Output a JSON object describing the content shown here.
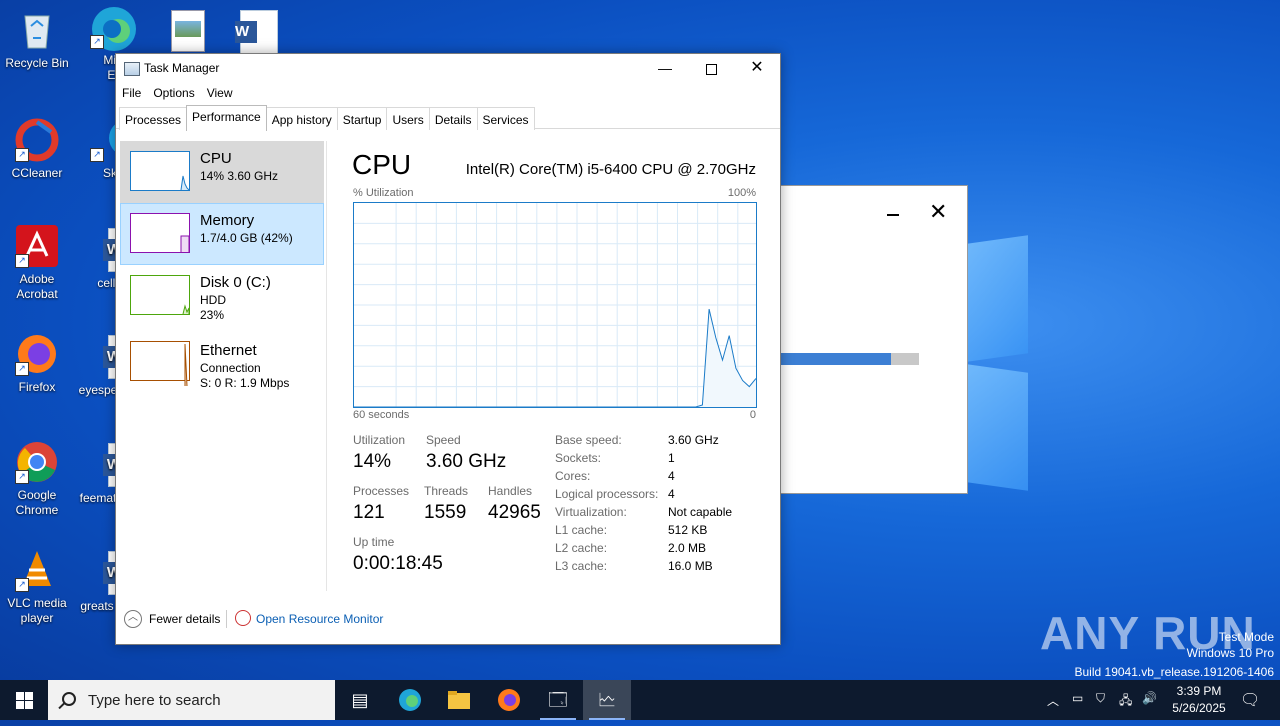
{
  "desktop": {
    "icons": [
      {
        "label": "Recycle Bin"
      },
      {
        "label": "Micro Edg"
      },
      {
        "label": "CCleaner"
      },
      {
        "label": "Sky"
      },
      {
        "label": "Adobe Acrobat"
      },
      {
        "label": "cellow"
      },
      {
        "label": "Firefox"
      },
      {
        "label": "eyespe"
      },
      {
        "label": "Google Chrome"
      },
      {
        "label": "feemat"
      },
      {
        "label": "VLC media player"
      },
      {
        "label": "greats"
      }
    ]
  },
  "task_manager": {
    "title": "Task Manager",
    "menu": [
      "File",
      "Options",
      "View"
    ],
    "tabs": [
      "Processes",
      "Performance",
      "App history",
      "Startup",
      "Users",
      "Details",
      "Services"
    ],
    "active_tab": "Performance",
    "resources": [
      {
        "name": "CPU",
        "line1": "14% 3.60 GHz",
        "line2": ""
      },
      {
        "name": "Memory",
        "line1": "1.7/4.0 GB (42%)",
        "line2": ""
      },
      {
        "name": "Disk 0 (C:)",
        "line1": "HDD",
        "line2": "23%"
      },
      {
        "name": "Ethernet",
        "line1": "Connection",
        "line2": "S: 0 R: 1.9 Mbps"
      }
    ],
    "detail": {
      "title": "CPU",
      "cpu_name": "Intel(R) Core(TM) i5-6400 CPU @ 2.70GHz",
      "y_label": "% Utilization",
      "y_max_label": "100%",
      "x_left_label": "60 seconds",
      "x_right_label": "0",
      "stats": {
        "utilization_label": "Utilization",
        "utilization": "14%",
        "speed_label": "Speed",
        "speed": "3.60 GHz",
        "processes_label": "Processes",
        "processes": "121",
        "threads_label": "Threads",
        "threads": "1559",
        "handles_label": "Handles",
        "handles": "42965",
        "uptime_label": "Up time",
        "uptime": "0:00:18:45"
      },
      "specs": [
        {
          "label": "Base speed:",
          "value": "3.60 GHz"
        },
        {
          "label": "Sockets:",
          "value": "1"
        },
        {
          "label": "Cores:",
          "value": "4"
        },
        {
          "label": "Logical processors:",
          "value": "4"
        },
        {
          "label": "Virtualization:",
          "value": "Not capable"
        },
        {
          "label": "L1 cache:",
          "value": "512 KB"
        },
        {
          "label": "L2 cache:",
          "value": "2.0 MB"
        },
        {
          "label": "L3 cache:",
          "value": "16.0 MB"
        }
      ],
      "utilization_history": [
        0,
        0,
        0,
        0,
        0,
        0,
        0,
        0,
        0,
        0,
        0,
        0,
        0,
        0,
        0,
        0,
        0,
        0,
        0,
        0,
        0,
        0,
        0,
        0,
        0,
        0,
        0,
        0,
        0,
        0,
        0,
        0,
        0,
        0,
        0,
        0,
        0,
        0,
        0,
        0,
        0,
        0,
        0,
        0,
        0,
        0,
        0,
        0,
        0,
        0,
        0,
        0,
        1,
        48,
        34,
        23,
        35,
        19,
        13,
        10,
        14
      ]
    },
    "footer": {
      "fewer_details": "Fewer details",
      "resource_monitor": "Open Resource Monitor"
    }
  },
  "background_dialog": {
    "progress": 0.8
  },
  "taskbar": {
    "search_placeholder": "Type here to search",
    "time": "3:39 PM",
    "date": "5/26/2025"
  },
  "watermark": {
    "line1": "Test Mode",
    "line2": "Windows 10 Pro",
    "line3": "Build 19041.vb_release.191206-1406",
    "brand": "ANY RUN"
  },
  "colors": {
    "accent": "#1b7bc8",
    "memory": "#8b12ae",
    "disk": "#4da60c",
    "ethernet": "#a74f01"
  }
}
